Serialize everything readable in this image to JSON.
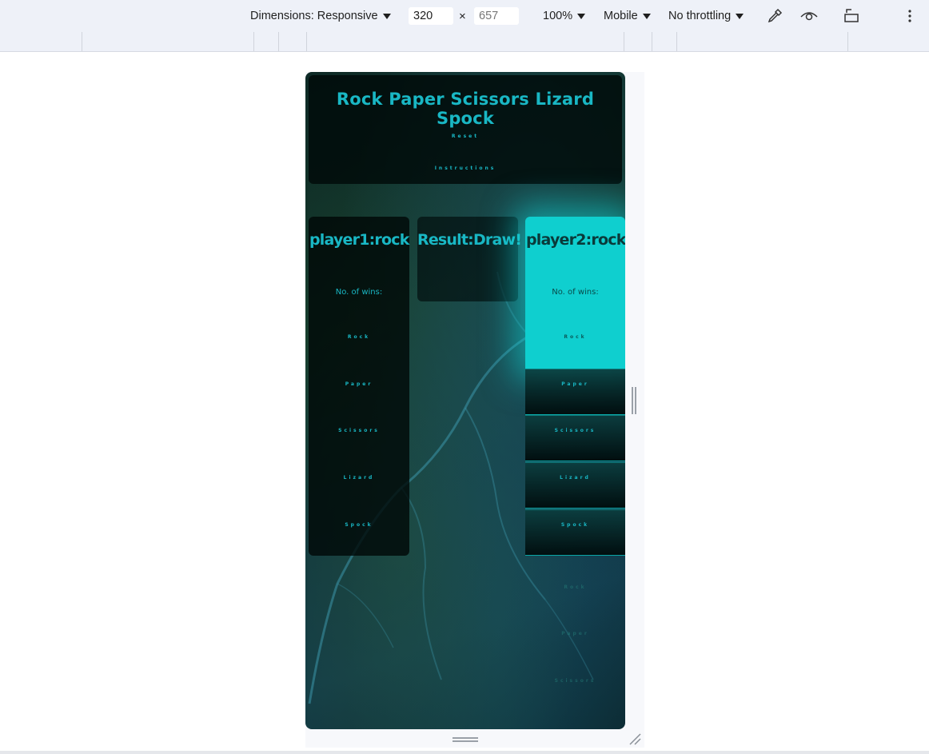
{
  "toolbar": {
    "dimensions_label": "Dimensions: Responsive",
    "width_value": "320",
    "times": "×",
    "height_value": "657",
    "zoom": "100%",
    "device": "Mobile",
    "throttling": "No throttling",
    "icons": [
      "eyedropper-icon",
      "eye-icon",
      "rotate-icon",
      "more-vert-icon"
    ]
  },
  "app": {
    "title": "Rock Paper Scissors Lizard Spock",
    "reset_label": "Reset",
    "instructions_label": "Instructions",
    "player1": {
      "heading": "player1:rock",
      "wins_label": "No. of wins:",
      "choices": [
        "Rock",
        "Paper",
        "Scissors",
        "Lizard",
        "Spock"
      ]
    },
    "result": {
      "heading": "Result:Draw!"
    },
    "player2": {
      "heading": "player2:rock",
      "wins_label": "No. of wins:",
      "choices": [
        "Rock",
        "Paper",
        "Scissors",
        "Lizard",
        "Spock"
      ]
    },
    "faint_choices": [
      "Rock",
      "Paper",
      "Scissors"
    ]
  },
  "colors": {
    "accent": "#19b7c4",
    "glow": "#0fcfcf"
  }
}
